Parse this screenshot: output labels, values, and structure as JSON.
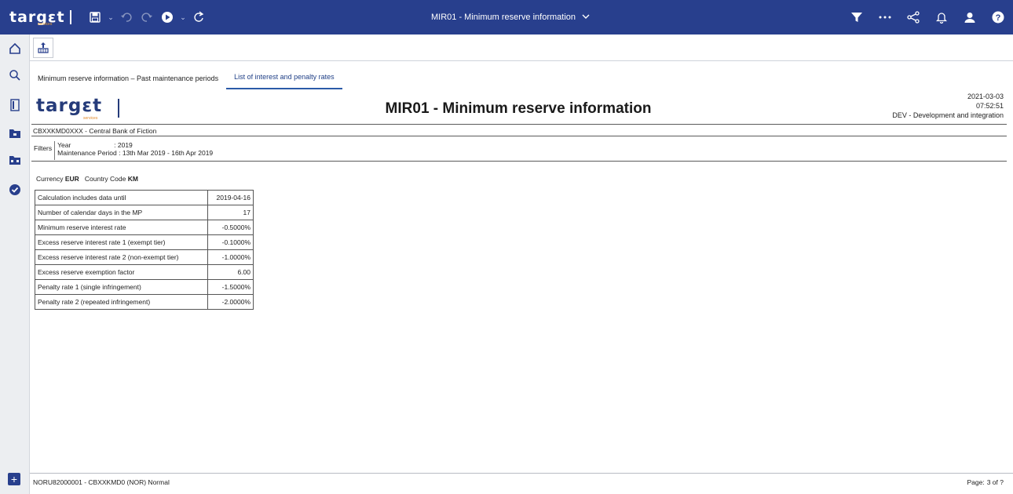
{
  "app": {
    "brand": "targεt",
    "brand_sub": "services",
    "report_selector_title": "MIR01 - Minimum reserve information"
  },
  "tabs": [
    {
      "label": "Minimum reserve information – Past maintenance periods",
      "active": false
    },
    {
      "label": "List of interest and penalty rates",
      "active": true
    }
  ],
  "report": {
    "logo_text": "targεt",
    "logo_sub": "services",
    "title": "MIR01 - Minimum reserve information",
    "date": "2021-03-03",
    "time": "07:52:51",
    "environment": "DEV - Development and integration",
    "organisation": "CBXXKMD0XXX - Central Bank of Fiction",
    "filters": {
      "label": "Filters",
      "year_key": "Year",
      "year_value": ": 2019",
      "period_key": "Maintenance Period",
      "period_value": ": 13th Mar 2019 - 16th Apr 2019"
    },
    "currency_label": "Currency",
    "currency_value": "EUR",
    "country_label": "Country Code",
    "country_value": "KM",
    "rows": [
      {
        "label": "Calculation includes data until",
        "value": "2019-04-16"
      },
      {
        "label": "Number of calendar days in the MP",
        "value": "17"
      },
      {
        "label": "Minimum reserve interest rate",
        "value": "-0.5000%"
      },
      {
        "label": "Excess reserve interest rate 1 (exempt tier)",
        "value": "-0.1000%"
      },
      {
        "label": "Excess reserve interest rate 2 (non-exempt tier)",
        "value": "-1.0000%"
      },
      {
        "label": "Excess reserve exemption factor",
        "value": "6.00"
      },
      {
        "label": "Penalty rate 1 (single infringement)",
        "value": "-1.5000%"
      },
      {
        "label": "Penalty rate 2 (repeated infringement)",
        "value": "-2.0000%"
      }
    ]
  },
  "footer": {
    "user": "NORU82000001 - CBXXKMD0 (NOR) Normal",
    "page_label": "Page:",
    "page_value": "3 of ?"
  },
  "colors": {
    "header_bg": "#283f8d",
    "tab_active": "#2b5aa8"
  },
  "icons": {
    "topbar": [
      "save-icon",
      "undo-icon",
      "redo-icon",
      "run-icon",
      "refresh-icon",
      "filter-icon",
      "more-icon",
      "share-icon",
      "bell-icon",
      "user-icon",
      "help-icon"
    ],
    "leftnav": [
      "home-icon",
      "search-icon",
      "reports-icon",
      "folder-icon",
      "team-folder-icon",
      "check-circle-icon",
      "add-icon"
    ]
  }
}
